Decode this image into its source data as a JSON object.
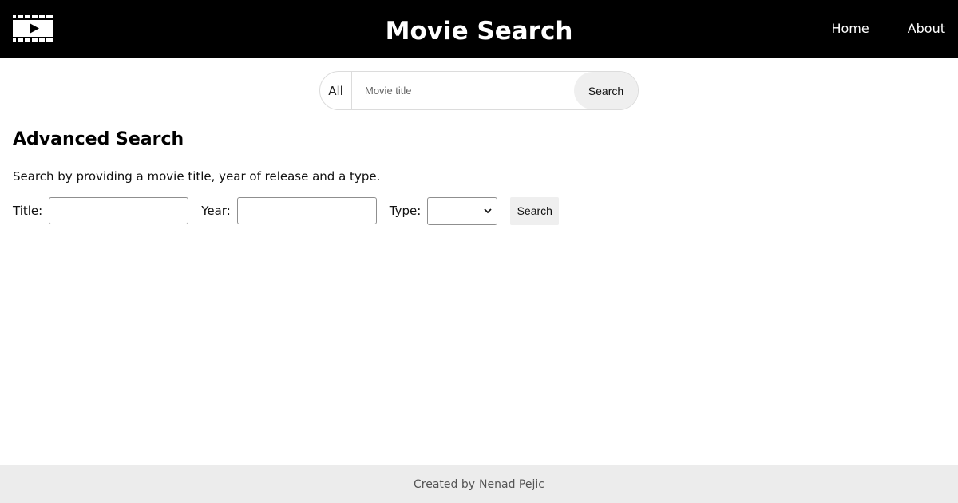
{
  "header": {
    "title": "Movie Search",
    "logo_icon": "film-play-icon",
    "nav": [
      {
        "label": "Home"
      },
      {
        "label": "About"
      }
    ]
  },
  "quick_search": {
    "category": "All",
    "placeholder": "Movie title",
    "value": "",
    "button_label": "Search"
  },
  "advanced_search": {
    "heading": "Advanced Search",
    "description": "Search by providing a movie title, year of release and a type.",
    "title_label": "Title:",
    "title_value": "",
    "year_label": "Year:",
    "year_value": "",
    "type_label": "Type:",
    "type_selected": "",
    "button_label": "Search"
  },
  "footer": {
    "prefix": "Created by",
    "author": "Nenad Pejic"
  },
  "colors": {
    "header_bg": "#000000",
    "footer_bg": "#ececec",
    "button_bg": "#efefef"
  }
}
